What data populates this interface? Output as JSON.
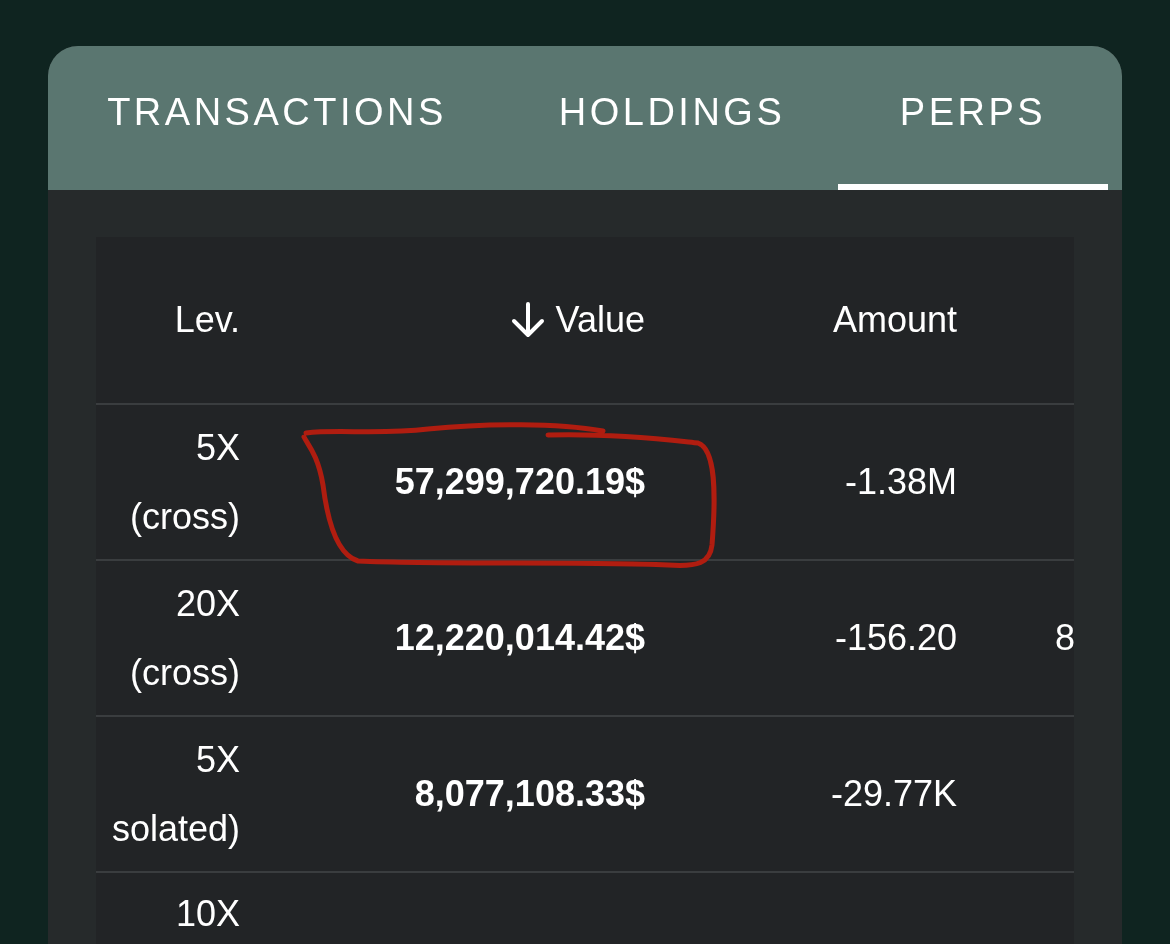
{
  "tabs": [
    {
      "label": "TRANSACTIONS",
      "selected": false
    },
    {
      "label": "HOLDINGS",
      "selected": false
    },
    {
      "label": "PERPS",
      "selected": true
    }
  ],
  "table": {
    "columns": [
      {
        "label": "Lev.",
        "sorted": false
      },
      {
        "label": "Value",
        "sorted": true
      },
      {
        "label": "Amount",
        "sorted": false
      }
    ],
    "rows": [
      {
        "lev": "5X",
        "margin": "(cross)",
        "value": "57,299,720.19$",
        "amount": "-1.38M",
        "circled": true
      },
      {
        "lev": "20X",
        "margin": "(cross)",
        "value": "12,220,014.42$",
        "amount": "-156.20",
        "column_4": "8",
        "circled": false
      },
      {
        "lev": "5X",
        "margin": "solated)",
        "value": "8,077,108.33$",
        "amount": "-29.77K",
        "circled": false
      },
      {
        "lev": "10X",
        "circled": false
      }
    ]
  }
}
